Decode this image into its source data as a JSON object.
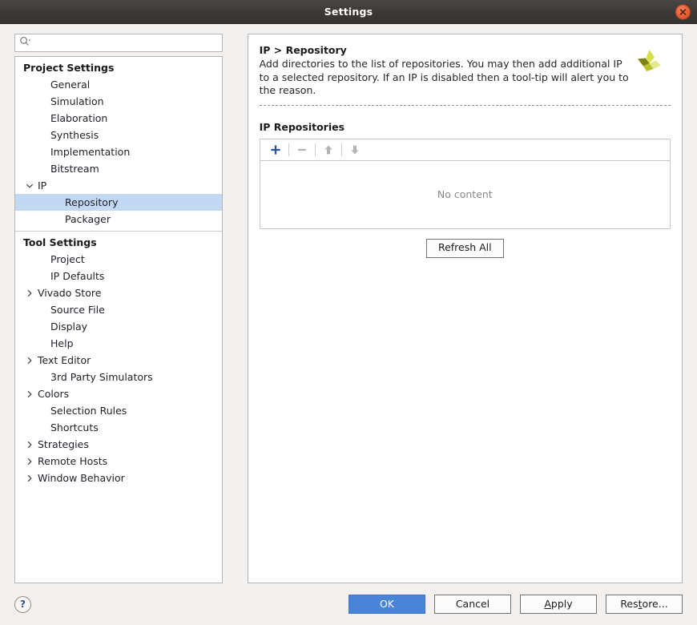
{
  "window": {
    "title": "Settings",
    "close_icon": "close-icon"
  },
  "search": {
    "value": "",
    "placeholder": "",
    "icon": "search-icon"
  },
  "sidebar": {
    "groups": [
      {
        "label": "Project Settings",
        "items": [
          {
            "label": "General",
            "level": 1,
            "twisty": "none",
            "selected": false
          },
          {
            "label": "Simulation",
            "level": 1,
            "twisty": "none",
            "selected": false
          },
          {
            "label": "Elaboration",
            "level": 1,
            "twisty": "none",
            "selected": false
          },
          {
            "label": "Synthesis",
            "level": 1,
            "twisty": "none",
            "selected": false
          },
          {
            "label": "Implementation",
            "level": 1,
            "twisty": "none",
            "selected": false
          },
          {
            "label": "Bitstream",
            "level": 1,
            "twisty": "none",
            "selected": false
          },
          {
            "label": "IP",
            "level": 1,
            "twisty": "expanded",
            "selected": false
          },
          {
            "label": "Repository",
            "level": 2,
            "twisty": "none",
            "selected": true
          },
          {
            "label": "Packager",
            "level": 2,
            "twisty": "none",
            "selected": false
          }
        ]
      },
      {
        "label": "Tool Settings",
        "items": [
          {
            "label": "Project",
            "level": 1,
            "twisty": "none",
            "selected": false
          },
          {
            "label": "IP Defaults",
            "level": 1,
            "twisty": "none",
            "selected": false
          },
          {
            "label": "Vivado Store",
            "level": 1,
            "twisty": "collapsed",
            "selected": false
          },
          {
            "label": "Source File",
            "level": 1,
            "twisty": "none",
            "selected": false
          },
          {
            "label": "Display",
            "level": 1,
            "twisty": "none",
            "selected": false
          },
          {
            "label": "Help",
            "level": 1,
            "twisty": "none",
            "selected": false
          },
          {
            "label": "Text Editor",
            "level": 1,
            "twisty": "collapsed",
            "selected": false
          },
          {
            "label": "3rd Party Simulators",
            "level": 1,
            "twisty": "none",
            "selected": false
          },
          {
            "label": "Colors",
            "level": 1,
            "twisty": "collapsed",
            "selected": false
          },
          {
            "label": "Selection Rules",
            "level": 1,
            "twisty": "none",
            "selected": false
          },
          {
            "label": "Shortcuts",
            "level": 1,
            "twisty": "none",
            "selected": false
          },
          {
            "label": "Strategies",
            "level": 1,
            "twisty": "collapsed",
            "selected": false
          },
          {
            "label": "Remote Hosts",
            "level": 1,
            "twisty": "collapsed",
            "selected": false
          },
          {
            "label": "Window Behavior",
            "level": 1,
            "twisty": "collapsed",
            "selected": false
          }
        ]
      }
    ]
  },
  "panel": {
    "title": "IP > Repository",
    "description": "Add directories to the list of repositories. You may then add additional IP to a selected repository. If an IP is disabled then a tool-tip will alert you to the reason.",
    "logo_icon": "vivado-pinwheel-logo-icon",
    "section_title": "IP Repositories",
    "toolbar": [
      {
        "name": "add-repository-button",
        "icon": "plus-icon",
        "enabled": true
      },
      {
        "name": "remove-repository-button",
        "icon": "minus-icon",
        "enabled": false
      },
      {
        "name": "move-repository-up-button",
        "icon": "arrow-up-icon",
        "enabled": false
      },
      {
        "name": "move-repository-down-button",
        "icon": "arrow-down-icon",
        "enabled": false
      }
    ],
    "empty_text": "No content",
    "refresh_label": "Refresh All"
  },
  "footer": {
    "help_label": "?",
    "buttons": [
      {
        "label": "OK",
        "primary": true,
        "mnemonic": ""
      },
      {
        "label": "Cancel",
        "primary": false,
        "mnemonic": ""
      },
      {
        "label": "Apply",
        "primary": false,
        "mnemonic": "A"
      },
      {
        "label": "Restore...",
        "primary": false,
        "mnemonic": "t"
      }
    ]
  },
  "colors": {
    "selection": "#c3d8f2",
    "primary_button": "#4a84d8",
    "accent_plus": "#2e5491",
    "titlebar": "#3c3836",
    "close_button": "#e8613a",
    "logo_dark": "#7d8211",
    "logo_light": "#d6de4a"
  }
}
